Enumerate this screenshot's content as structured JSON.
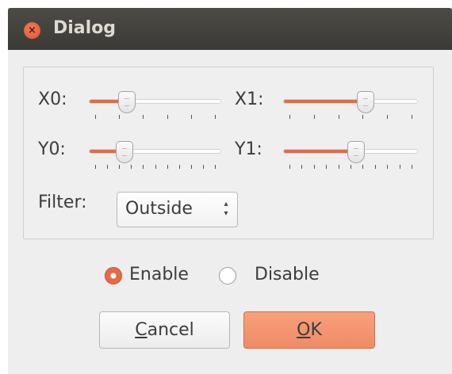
{
  "window": {
    "title": "Dialog",
    "close_glyph": "×"
  },
  "parameters": {
    "x0": {
      "label": "X0:",
      "value_fraction": 0.29,
      "tick_count": 6
    },
    "x1": {
      "label": "X1:",
      "value_fraction": 0.61,
      "tick_count": 6
    },
    "y0": {
      "label": "Y0:",
      "value_fraction": 0.27,
      "tick_count": 11
    },
    "y1": {
      "label": "Y1:",
      "value_fraction": 0.54,
      "tick_count": 11
    },
    "filter": {
      "label": "Filter:",
      "value": "Outside",
      "arrows": "▴▾"
    }
  },
  "mode": {
    "enable_label": "Enable",
    "disable_label": "Disable",
    "selected": "enable"
  },
  "buttons": {
    "cancel_mnemonic": "C",
    "cancel_rest": "ancel",
    "ok_mnemonic": "O",
    "ok_rest": "K"
  },
  "colors": {
    "accent": "#e56a46",
    "ok_button": "#f08b66",
    "titlebar": "#3f3e3a"
  }
}
